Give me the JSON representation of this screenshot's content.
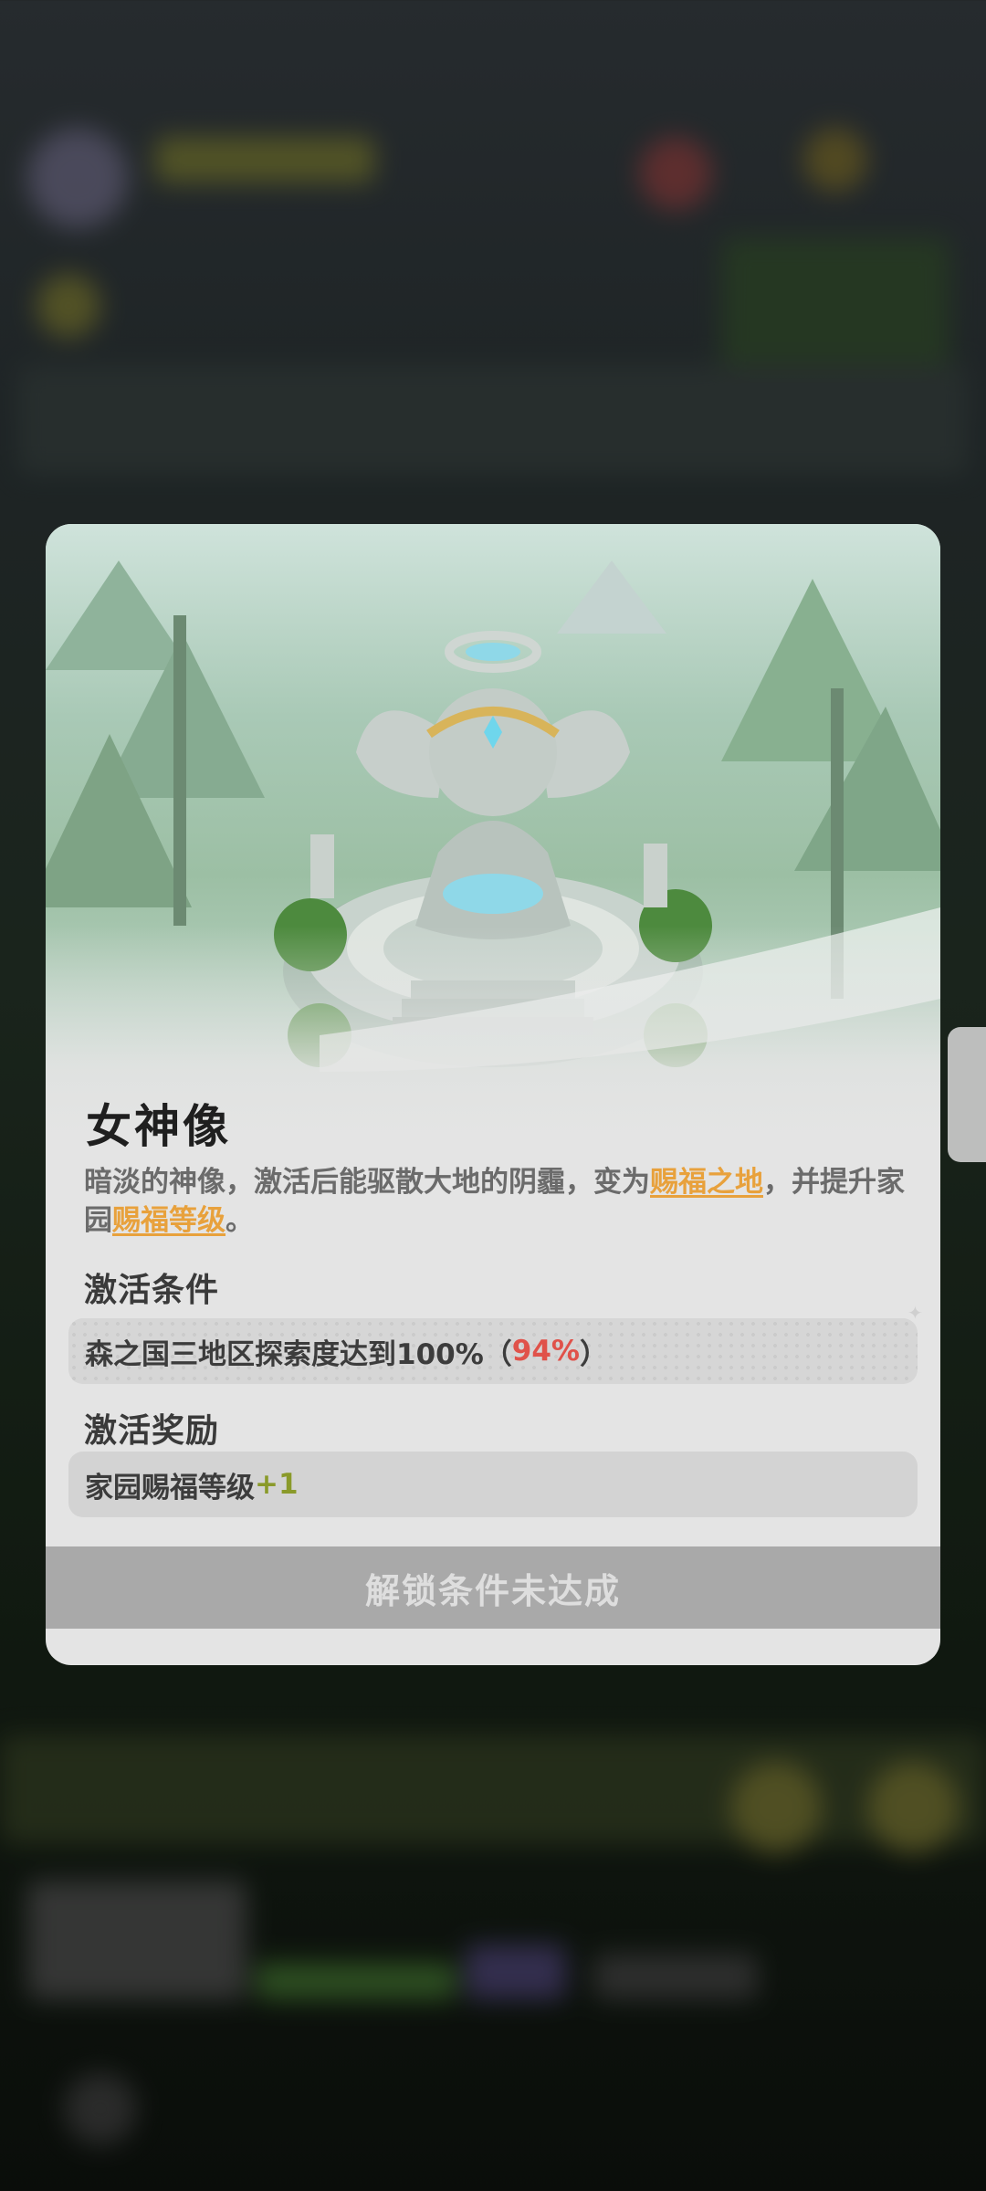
{
  "modal": {
    "title": "女神像",
    "description": {
      "part1": "暗淡的神像，激活后能驱散大地的阴霾，变为",
      "highlight1": "赐福之地",
      "part2": "，并提升家园",
      "highlight2": "赐福等级",
      "part3": "。"
    },
    "condition": {
      "heading": "激活条件",
      "text": "森之国三地区探索度达到100%（",
      "progress": "94%",
      "suffix": "）"
    },
    "reward": {
      "heading": "激活奖励",
      "text": "家园赐福等级",
      "bonus": "+1"
    },
    "button_label": "解锁条件未达成"
  },
  "colors": {
    "highlight": "#e8a13c",
    "progress": "#e0524a",
    "bonus": "#8a9a2a",
    "button_disabled": "#a9a9a9"
  },
  "icons": {
    "statue": "goddess-statue-illustration",
    "sparkle": "sparkle-icon"
  }
}
